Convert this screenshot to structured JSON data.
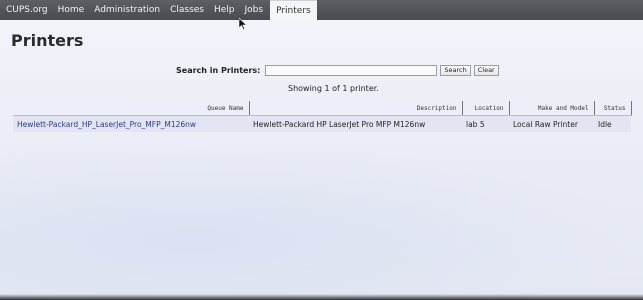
{
  "nav": {
    "items": [
      {
        "label": "CUPS.org",
        "active": false
      },
      {
        "label": "Home",
        "active": false
      },
      {
        "label": "Administration",
        "active": false
      },
      {
        "label": "Classes",
        "active": false
      },
      {
        "label": "Help",
        "active": false
      },
      {
        "label": "Jobs",
        "active": false
      },
      {
        "label": "Printers",
        "active": true
      }
    ]
  },
  "page": {
    "title": "Printers"
  },
  "search": {
    "label": "Search in Printers:",
    "value": "",
    "search_button": "Search",
    "clear_button": "Clear"
  },
  "results": {
    "summary": "Showing 1 of 1 printer."
  },
  "table": {
    "headers": {
      "queue_name": "Queue Name",
      "description": "Description",
      "location": "Location",
      "make_and_model": "Make and Model",
      "status": "Status"
    },
    "rows": [
      {
        "queue_name": "Hewlett-Packard_HP_LaserJet_Pro_MFP_M126nw",
        "description": "Hewlett-Packard HP LaserJet Pro MFP M126nw",
        "location": "lab 5",
        "make_and_model": "Local Raw Printer",
        "status": "Idle"
      }
    ]
  },
  "colors": {
    "nav_background": "#4f5055",
    "link": "#2d3a8c",
    "page_background": "#eef0f8"
  }
}
